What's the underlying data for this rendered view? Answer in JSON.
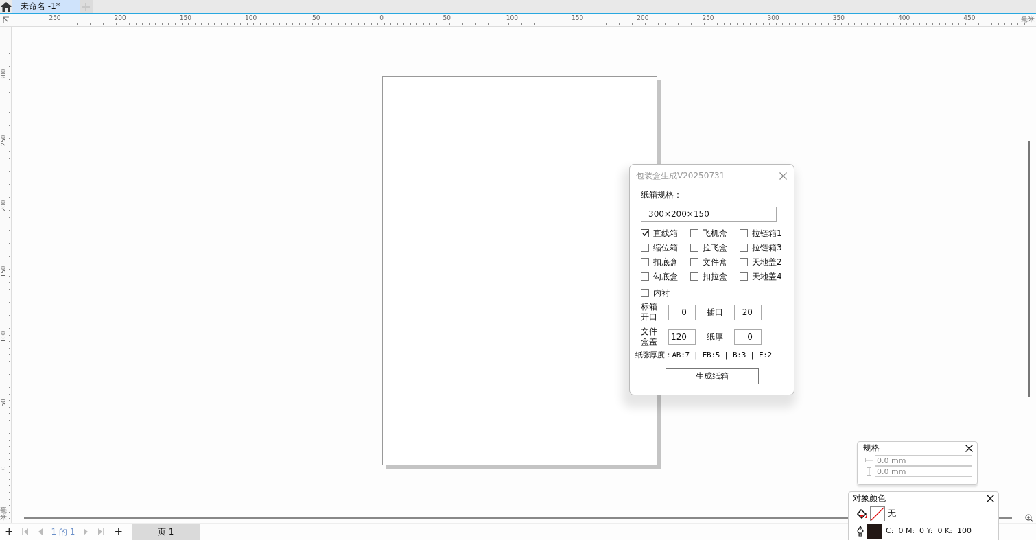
{
  "tabs": [
    {
      "label": "未命名 -1*",
      "selected": true
    }
  ],
  "ruler": {
    "h_labels": [
      "250",
      "200",
      "150",
      "100",
      "50",
      "0",
      "50",
      "100",
      "150",
      "200",
      "250",
      "300",
      "350",
      "400",
      "450"
    ],
    "h_unit": "毫米",
    "v_labels": [
      "300",
      "250",
      "200",
      "150",
      "100",
      "50",
      "0"
    ],
    "v_unit": "毫米"
  },
  "dialog": {
    "title": "包装盒生成V20250731",
    "spec_label": "纸箱规格：",
    "spec_value": "300×200×150",
    "options": [
      {
        "label": "直线箱",
        "checked": true
      },
      {
        "label": "飞机盒",
        "checked": false
      },
      {
        "label": "拉链箱1",
        "checked": false
      },
      {
        "label": "缩位箱",
        "checked": false
      },
      {
        "label": "拉飞盒",
        "checked": false
      },
      {
        "label": "拉链箱3",
        "checked": false
      },
      {
        "label": "扣底盒",
        "checked": false
      },
      {
        "label": "文件盒",
        "checked": false
      },
      {
        "label": "天地盖2",
        "checked": false
      },
      {
        "label": "勾底盒",
        "checked": false
      },
      {
        "label": "扣拉盒",
        "checked": false
      },
      {
        "label": "天地盖4",
        "checked": false
      }
    ],
    "lining": {
      "label": "内衬",
      "checked": false
    },
    "fields": [
      {
        "label": "标箱开口",
        "value": "0"
      },
      {
        "label": "插口",
        "value": "20"
      },
      {
        "label": "文件盒盖",
        "value": "120"
      },
      {
        "label": "纸厚",
        "value": "0"
      }
    ],
    "thickness_note": "纸张厚度：AB:7 | EB:5 | B:3 | E:2",
    "button": "生成纸箱"
  },
  "size_panel": {
    "title": "规格",
    "width": "0.0 mm",
    "height": "0.0 mm"
  },
  "color_panel": {
    "title": "对象颜色",
    "fill": "无",
    "outline": "C:  0 M:  0 Y:  0 K:  100"
  },
  "page_nav": {
    "add_left": "+",
    "position": "1 的 1",
    "add_right": "+",
    "page_tab": "页 1"
  }
}
